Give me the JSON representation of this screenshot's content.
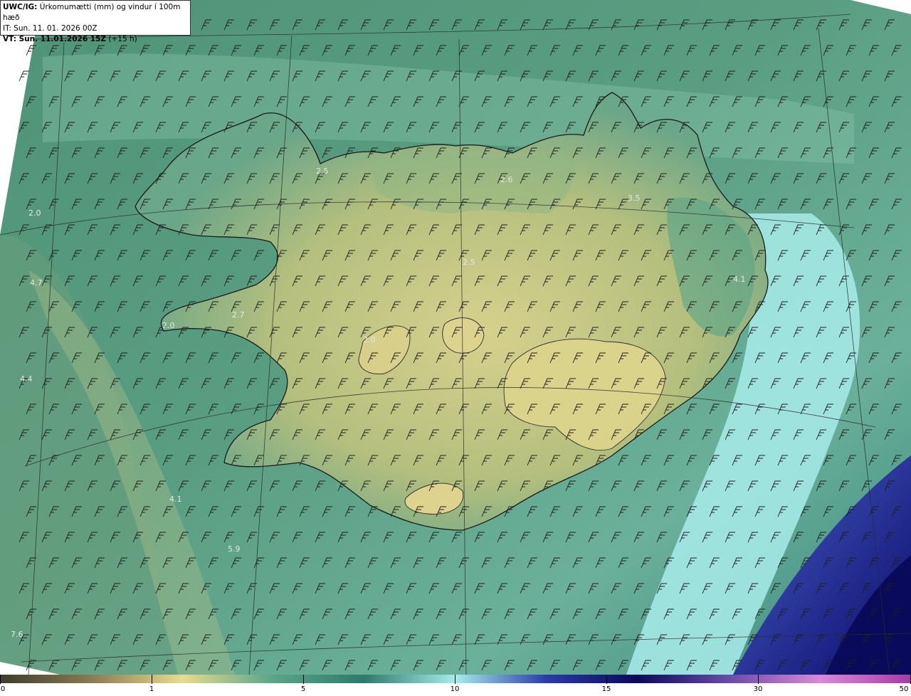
{
  "header": {
    "product_code": "UWC/IG:",
    "title": "Úrkomumætti (mm) og vindur í 100m hæð",
    "issue_time": "IT: Sun. 11. 01. 2026 00Z",
    "valid_time_label": "VT: Sun. 11.01.2026 15Z",
    "lead_time": "(+15 h)"
  },
  "colorbar": {
    "ticks": [
      "0",
      "1",
      "5",
      "10",
      "15",
      "30",
      "50"
    ],
    "colors": [
      "#3d3d2a",
      "#8a7a55",
      "#e8dc8e",
      "#5aa48a",
      "#2e7a6a",
      "#a6ecec",
      "#2a3aa8",
      "#0a0a5a",
      "#6a4aa8",
      "#d88ad8",
      "#a83aa8"
    ]
  },
  "map": {
    "field_colors": {
      "land": "#c9c983",
      "coast_green": "#4e9a7e",
      "sea": "#4a8f78",
      "moist_band": "#9ee6e0",
      "heavy": "#1a1a7a",
      "coastline": "#1a1a1a",
      "graticule": "#2a2a2a"
    },
    "value_labels": [
      "4.7",
      "4.4",
      "4.1",
      "5.9",
      "7.6",
      "2.0",
      "2.0",
      "2.7",
      "2.5",
      "2.6",
      "3.5",
      "4.1",
      "2.0",
      "2.5"
    ]
  }
}
